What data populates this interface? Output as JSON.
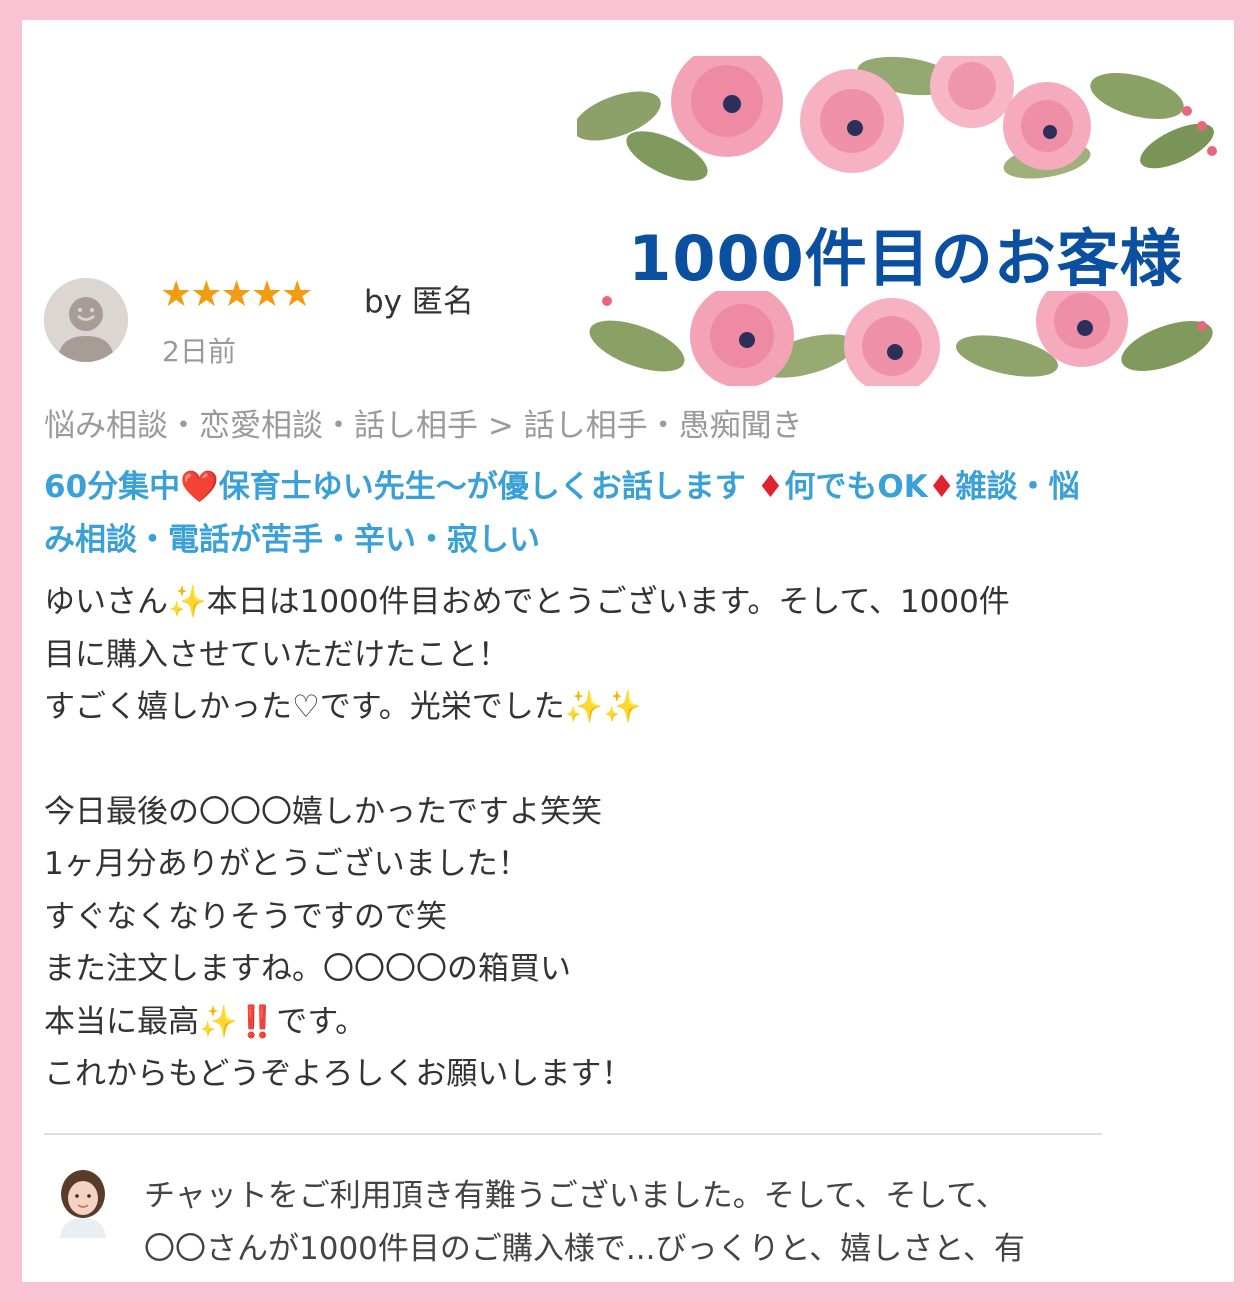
{
  "banner": {
    "title": "1000件目のお客様"
  },
  "review": {
    "stars": "★★★★★",
    "by_label": "by 匿名",
    "posted_ago": "2日前",
    "category": "悩み相談・恋愛相談・話し相手 > 話し相手・愚痴聞き",
    "service_title": {
      "part1": "60分集中",
      "heart": "❤️",
      "part2": "保育士ゆい先生〜が優しくお話します ",
      "diamond1": "♦",
      "part3": "何でもOK",
      "diamond2": "♦",
      "part4": "雑談・悩み相談・電話が苦手・辛い・寂しい"
    },
    "body": {
      "l1a": "ゆいさん",
      "l1b": "本日は1000件目おめでとうございます。そして、1000件",
      "l2": "目に購入させていただけたこと！",
      "l3a": "すごく嬉しかった♡です。光栄でした",
      "l4": "",
      "l5": "今日最後の〇〇〇嬉しかったですよ笑笑",
      "l6": "1ヶ月分ありがとうございました！",
      "l7": "すぐなくなりそうですので笑",
      "l8": "また注文しますね。〇〇〇〇の箱買い",
      "l9a": "本当に最高",
      "l9b": "です。",
      "l10": "これからもどうぞよろしくお願いします！"
    },
    "emoji": {
      "sparkles": "✨",
      "double_bang": "‼️"
    }
  },
  "reply": {
    "line1": "チャットをご利用頂き有難うございました。そして、そして、",
    "line2": "〇〇さんが1000件目のご購入様で...びっくりと、嬉しさと、有"
  },
  "colors": {
    "frame": "#f9c3d3",
    "banner_title": "#0b4fa0",
    "service_title": "#3aa0d8",
    "stars": "#f39c12"
  }
}
